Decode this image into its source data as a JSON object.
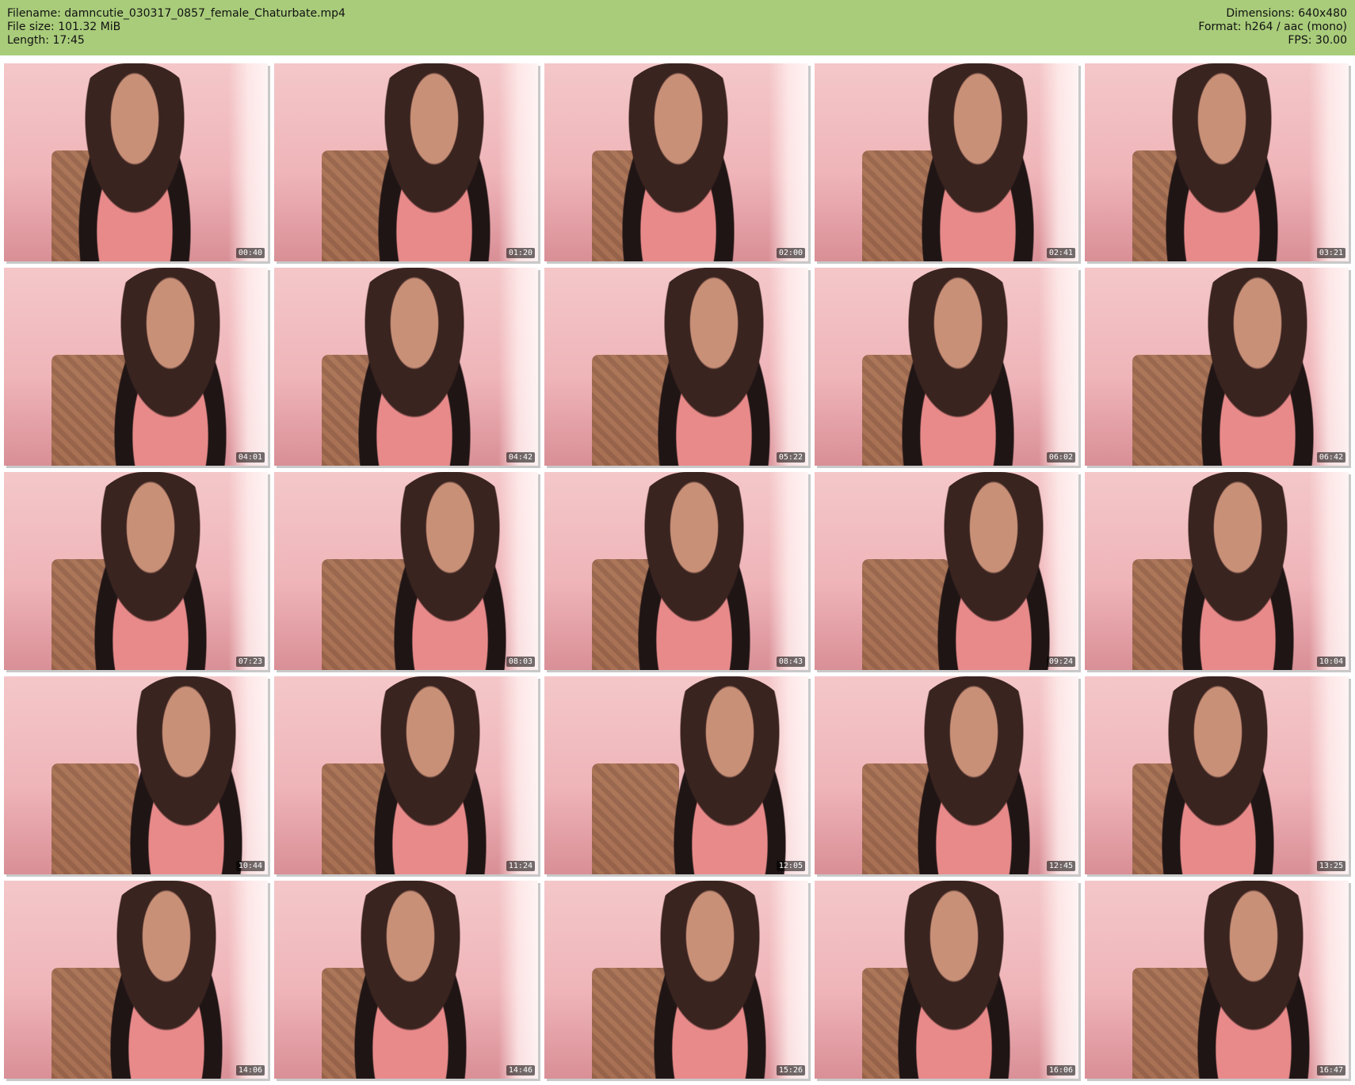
{
  "header": {
    "filename_line": "Filename: damncutie_030317_0857_female_Chaturbate.mp4",
    "filesize_line": "File size: 101.32 MiB",
    "length_line": "Length: 17:45",
    "dimensions_line": "Dimensions: 640x480",
    "format_line": "Format: h264 / aac (mono)",
    "fps_line": "FPS: 30.00"
  },
  "thumbnails": [
    {
      "time": "00:40"
    },
    {
      "time": "01:20"
    },
    {
      "time": "02:00"
    },
    {
      "time": "02:41"
    },
    {
      "time": "03:21"
    },
    {
      "time": "04:01"
    },
    {
      "time": "04:42"
    },
    {
      "time": "05:22"
    },
    {
      "time": "06:02"
    },
    {
      "time": "06:42"
    },
    {
      "time": "07:23"
    },
    {
      "time": "08:03"
    },
    {
      "time": "08:43"
    },
    {
      "time": "09:24"
    },
    {
      "time": "10:04"
    },
    {
      "time": "10:44"
    },
    {
      "time": "11:24"
    },
    {
      "time": "12:05"
    },
    {
      "time": "12:45"
    },
    {
      "time": "13:25"
    },
    {
      "time": "14:06"
    },
    {
      "time": "14:46"
    },
    {
      "time": "15:26"
    },
    {
      "time": "16:06"
    },
    {
      "time": "16:47"
    }
  ],
  "colors": {
    "header_bg": "#a9cc7b",
    "timestamp_bg": "#000000"
  }
}
